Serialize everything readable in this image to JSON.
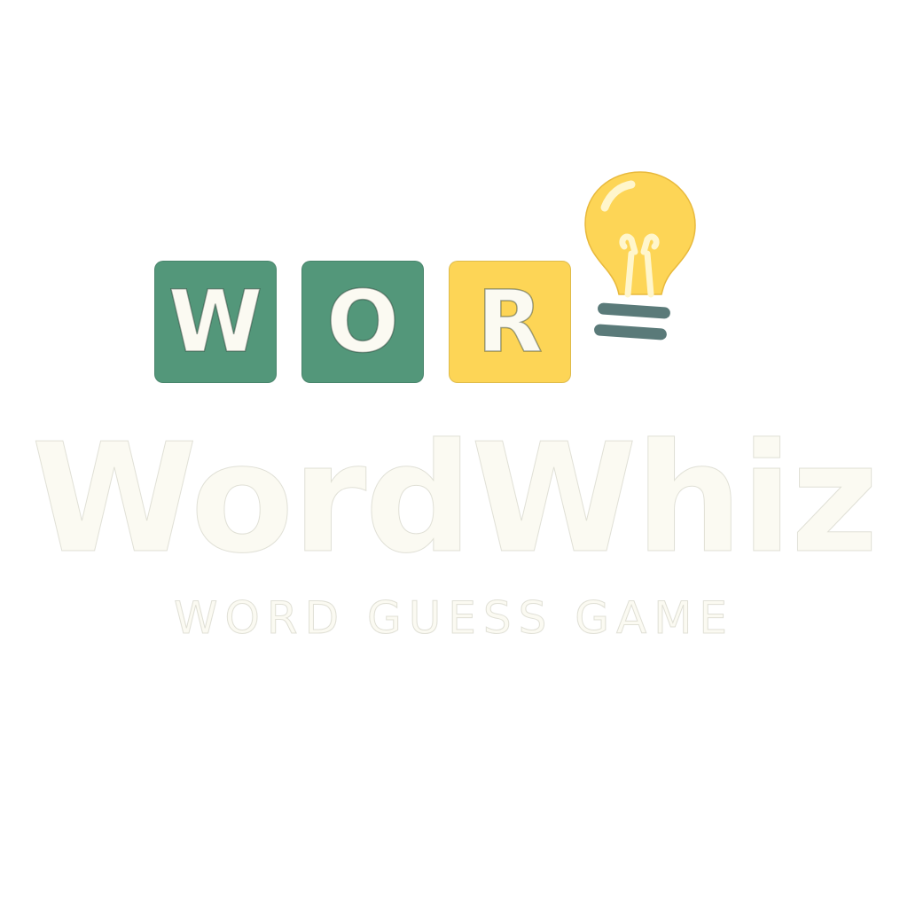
{
  "logo": {
    "tiles": [
      {
        "letter": "W",
        "color": "#53977a"
      },
      {
        "letter": "O",
        "color": "#53977a"
      },
      {
        "letter": "R",
        "color": "#fdd556"
      }
    ],
    "bulb_icon": "lightbulb-icon",
    "bulb_color": "#fdd556",
    "bulb_base_color": "#5a7a79"
  },
  "title": "WordWhiz",
  "subtitle": "WORD GUESS GAME"
}
